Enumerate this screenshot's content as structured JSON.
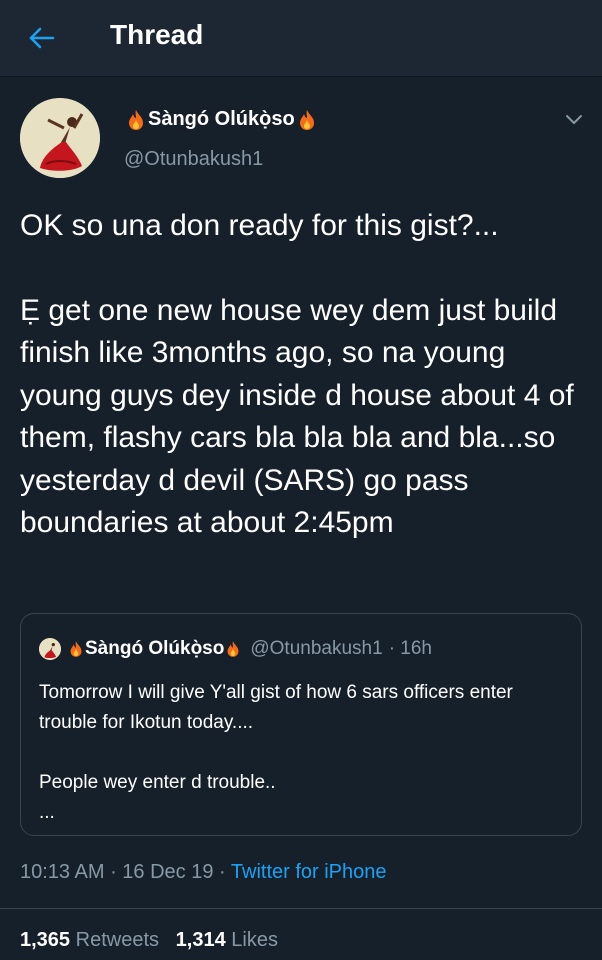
{
  "header": {
    "title": "Thread",
    "back_icon": "arrow-left-icon"
  },
  "colors": {
    "background": "#15202b",
    "header_bg": "#1c2733",
    "accent": "#1da1f2",
    "muted": "#8899a6",
    "border": "#38444d"
  },
  "tweet": {
    "author": {
      "name": "Sàngó Olúkọ̀so",
      "handle": "@Otunbakush1",
      "avatar_icon": "dancer-avatar-icon",
      "name_emoji": "fire-icon"
    },
    "menu_icon": "chevron-down-icon",
    "text": {
      "line1": "OK so una don ready for this gist?...",
      "line2": "Ẹ get one new house wey dem just build finish like 3months ago, so na young young guys dey inside d house about 4 of them, flashy cars bla bla bla and bla...so yesterday d devil (SARS) go pass boundaries at about 2:45pm"
    },
    "quoted": {
      "name": "Sàngó Olúkọ̀so",
      "handle": "@Otunbakush1",
      "time": "· 16h",
      "line1": "Tomorrow I will give Y'all gist of how 6 sars officers enter trouble for Ikotun today....",
      "line2": "People wey enter d trouble..",
      "line3": "..."
    },
    "meta": {
      "time": "10:13 AM",
      "sep1": " · ",
      "date": "16 Dec 19",
      "sep2": " · ",
      "source": "Twitter for iPhone"
    },
    "stats": {
      "retweets_count": "1,365",
      "retweets_label": "Retweets",
      "likes_count": "1,314",
      "likes_label": "Likes"
    }
  }
}
